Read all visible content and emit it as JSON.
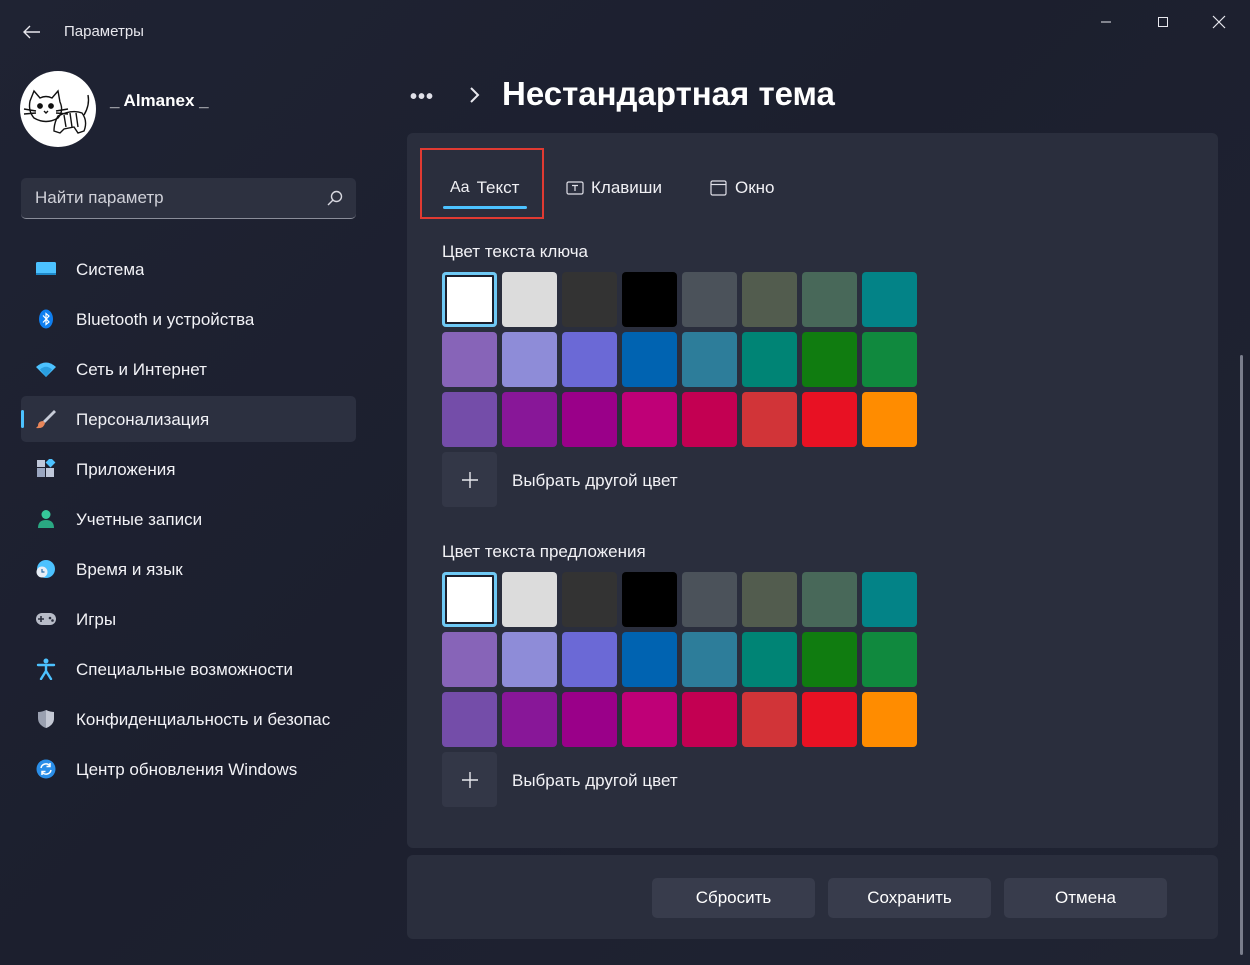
{
  "window": {
    "title": "Параметры"
  },
  "profile": {
    "username": "_ Almanex _"
  },
  "search": {
    "placeholder": "Найти параметр"
  },
  "sidebar": {
    "items": [
      {
        "label": "Система",
        "icon": "monitor-icon",
        "color": "#4cc2ff"
      },
      {
        "label": "Bluetooth и устройства",
        "icon": "bluetooth-icon",
        "color": "#0f7ff0"
      },
      {
        "label": "Сеть и Интернет",
        "icon": "wifi-icon",
        "color": "#4cc2ff"
      },
      {
        "label": "Персонализация",
        "icon": "brush-icon",
        "color": "#e89a6a",
        "active": true
      },
      {
        "label": "Приложения",
        "icon": "apps-icon",
        "color": "#9aa6c0"
      },
      {
        "label": "Учетные записи",
        "icon": "person-icon",
        "color": "#36c79a"
      },
      {
        "label": "Время и язык",
        "icon": "globe-clock-icon",
        "color": "#4cc2ff"
      },
      {
        "label": "Игры",
        "icon": "gamepad-icon",
        "color": "#b8bcc8"
      },
      {
        "label": "Специальные возможности",
        "icon": "accessibility-icon",
        "color": "#4cc2ff"
      },
      {
        "label": "Конфиденциальность и безопас",
        "icon": "shield-icon",
        "color": "#9aa0b0"
      },
      {
        "label": "Центр обновления Windows",
        "icon": "update-icon",
        "color": "#2a8ee8"
      }
    ]
  },
  "breadcrumb": {
    "dots": "•••",
    "title": "Нестандартная тема"
  },
  "tabs": [
    {
      "label": "Текст",
      "icon_text": "Aa",
      "active": true
    },
    {
      "label": "Клавиши",
      "icon": "keyboard-icon"
    },
    {
      "label": "Окно",
      "icon": "window-icon"
    }
  ],
  "sections": [
    {
      "label": "Цвет текста ключа",
      "add_label": "Выбрать другой цвет"
    },
    {
      "label": "Цвет текста предложения",
      "add_label": "Выбрать другой цвет"
    }
  ],
  "palette": [
    "#ffffff",
    "#dcdcdc",
    "#333333",
    "#000000",
    "#4b525a",
    "#525c4e",
    "#486859",
    "#038387",
    "#8764b8",
    "#8e8cd8",
    "#6b69d6",
    "#0063b1",
    "#2d7d9a",
    "#008475",
    "#107c10",
    "#10893e",
    "#744da9",
    "#881798",
    "#9a0089",
    "#bf0077",
    "#c30052",
    "#d13438",
    "#e81123",
    "#ff8c00"
  ],
  "selected_index": 0,
  "footer": {
    "reset": "Сбросить",
    "save": "Сохранить",
    "cancel": "Отмена"
  },
  "colors": {
    "accent": "#4cc2ff",
    "highlight": "#e03a32"
  }
}
